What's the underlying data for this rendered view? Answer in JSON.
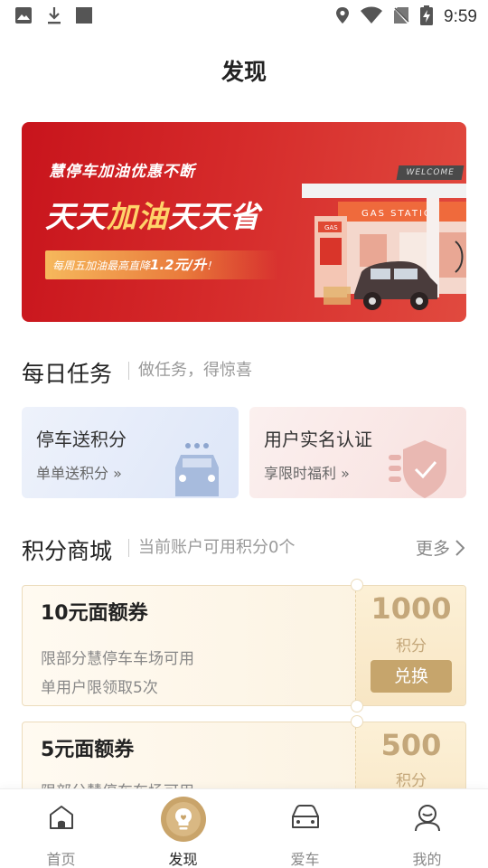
{
  "status_bar": {
    "time": "9:59"
  },
  "page": {
    "title": "发现"
  },
  "banner": {
    "subtitle": "慧停车加油优惠不断",
    "title_part1": "天天",
    "title_highlight": "加油",
    "title_part2": "天天省",
    "promo_prefix": "每周五加油最高直降",
    "promo_value": "1.2元/升",
    "promo_suffix": "！",
    "welcome_sign": "WELCOME",
    "station_sign": "GAS  STATIO",
    "pump_sign": "GAS"
  },
  "daily_tasks": {
    "title": "每日任务",
    "subtitle": "做任务，得惊喜",
    "cards": [
      {
        "title": "停车送积分",
        "sub": "单单送积分 »"
      },
      {
        "title": "用户实名认证",
        "sub": "享限时福利 »"
      }
    ]
  },
  "points_mall": {
    "title": "积分商城",
    "subtitle": "当前账户可用积分0个",
    "more": "更多",
    "coupons": [
      {
        "title": "10元面额券",
        "line1": "限部分慧停车车场可用",
        "line2": "单用户限领取5次",
        "points": "1000",
        "unit": "积分",
        "button": "兑换"
      },
      {
        "title": "5元面额券",
        "line1": "限部分慧停车车场可用",
        "points": "500",
        "unit": "积分"
      }
    ]
  },
  "tabbar": {
    "tabs": [
      {
        "label": "首页"
      },
      {
        "label": "发现"
      },
      {
        "label": "爱车"
      },
      {
        "label": "我的"
      }
    ]
  },
  "colors": {
    "brand_gold": "#c6a56c",
    "banner_red": "#d52a2a"
  }
}
